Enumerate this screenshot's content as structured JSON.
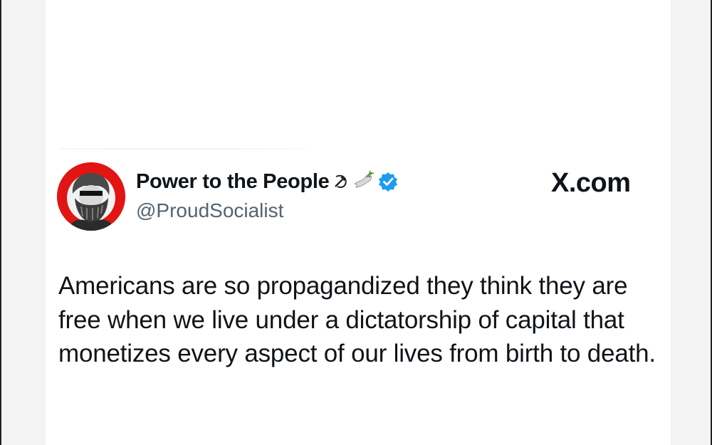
{
  "tweet": {
    "display_name": "Power to the People",
    "handle": "@ProudSocialist",
    "brand": "X.com",
    "body": "Americans are so propagandized they think they are free when we live under a dictatorship of capital that monetizes every aspect of our lives from birth to death.",
    "emoji": [
      "hammer-and-sickle",
      "dove-with-olive-branch"
    ],
    "verified": true
  },
  "colors": {
    "avatar_background": "#e31414",
    "verified_badge": "#1d9bf0",
    "text_primary": "#0f1419",
    "text_secondary": "#536471"
  }
}
